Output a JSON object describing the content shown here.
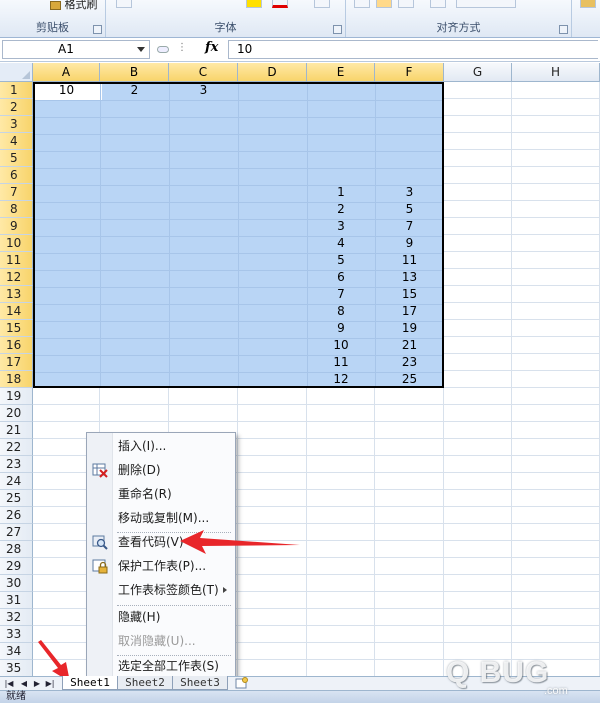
{
  "ribbon": {
    "clipboard": {
      "group_label": "剪贴板",
      "format_painter": "格式刷"
    },
    "font": {
      "group_label": "字体"
    },
    "alignment": {
      "group_label": "对齐方式"
    }
  },
  "formula_bar": {
    "name_box": "A1",
    "fx_label": "fx",
    "formula_value": "10"
  },
  "columns": [
    "A",
    "B",
    "C",
    "D",
    "E",
    "F",
    "G",
    "H"
  ],
  "selected_columns": [
    "A",
    "B",
    "C",
    "D",
    "E",
    "F"
  ],
  "rows": [
    "1",
    "2",
    "3",
    "4",
    "5",
    "6",
    "7",
    "8",
    "9",
    "10",
    "11",
    "12",
    "13",
    "14",
    "15",
    "16",
    "17",
    "18",
    "19",
    "20",
    "21",
    "22",
    "23",
    "24",
    "25",
    "26",
    "27",
    "28",
    "29",
    "30",
    "31",
    "32",
    "33",
    "34",
    "35"
  ],
  "selected_rows": 18,
  "cells": {
    "A1": "10",
    "B1": "2",
    "C1": "3",
    "E7": "1",
    "F7": "3",
    "E8": "2",
    "F8": "5",
    "E9": "3",
    "F9": "7",
    "E10": "4",
    "F10": "9",
    "E11": "5",
    "F11": "11",
    "E12": "6",
    "F12": "13",
    "E13": "7",
    "F13": "15",
    "E14": "8",
    "F14": "17",
    "E15": "9",
    "F15": "19",
    "E16": "10",
    "F16": "21",
    "E17": "11",
    "F17": "23",
    "E18": "12",
    "F18": "25"
  },
  "context_menu": {
    "items": [
      {
        "label": "插入(I)...",
        "icon": "none",
        "enabled": true
      },
      {
        "label": "删除(D)",
        "icon": "delete-sheet-icon",
        "enabled": true
      },
      {
        "label": "重命名(R)",
        "icon": "none",
        "enabled": true
      },
      {
        "label": "移动或复制(M)...",
        "icon": "none",
        "enabled": true
      },
      {
        "label": "查看代码(V)",
        "icon": "view-code-icon",
        "enabled": true
      },
      {
        "label": "保护工作表(P)...",
        "icon": "protect-sheet-icon",
        "enabled": true
      },
      {
        "label": "工作表标签颜色(T)",
        "icon": "none",
        "enabled": true,
        "submenu": true
      },
      {
        "label": "隐藏(H)",
        "icon": "none",
        "enabled": true
      },
      {
        "label": "取消隐藏(U)...",
        "icon": "none",
        "enabled": false
      },
      {
        "label": "选定全部工作表(S)",
        "icon": "none",
        "enabled": true
      }
    ]
  },
  "sheet_tabs": [
    {
      "label": "Sheet1",
      "active": true
    },
    {
      "label": "Sheet2",
      "active": false
    },
    {
      "label": "Sheet3",
      "active": false
    }
  ],
  "status_bar": {
    "text": "就绪"
  },
  "watermark": {
    "text": "Q BUG",
    "sub": ".com"
  },
  "colors": {
    "selection": "#b9d5f5",
    "header_selected": "#f8d46b",
    "arrow": "#e8262a"
  }
}
